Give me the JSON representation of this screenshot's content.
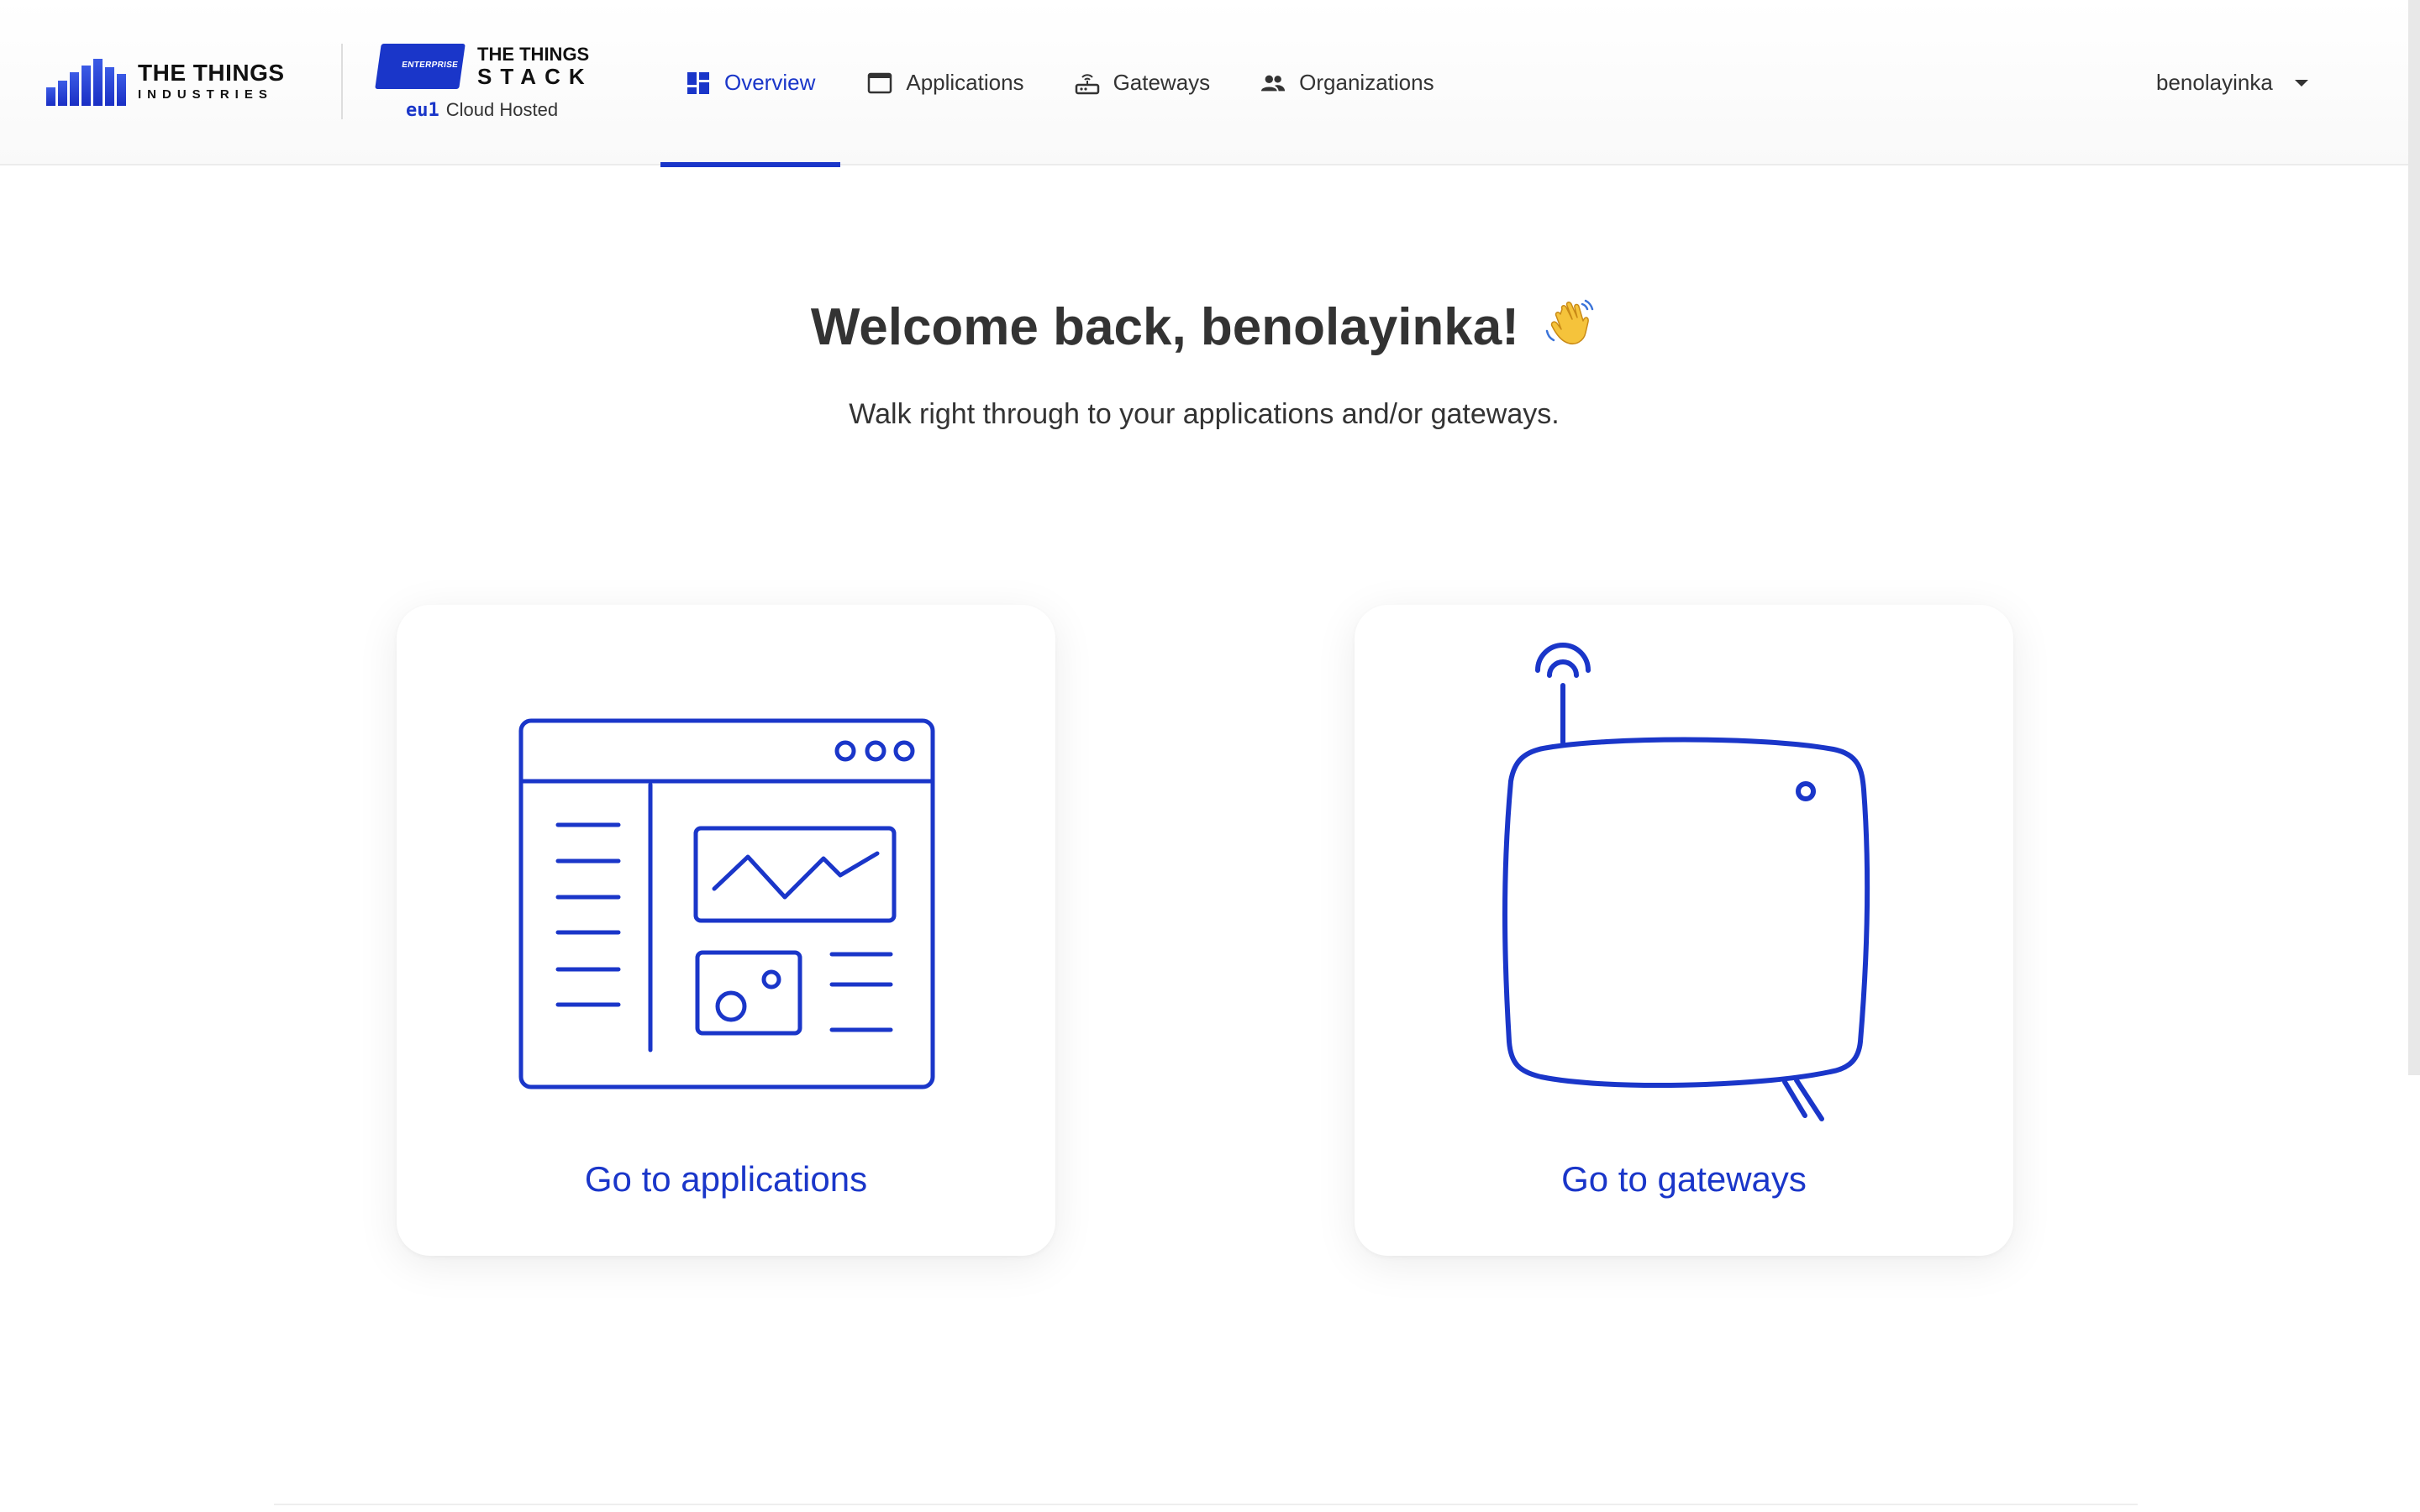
{
  "header": {
    "brand_line1": "THE THINGS",
    "brand_line2": "INDUSTRIES",
    "product_badge": "ENTERPRISE",
    "product_line1": "THE THINGS",
    "product_line2": "STACK",
    "cluster": "eu1",
    "hosting": "Cloud Hosted",
    "nav": [
      {
        "label": "Overview",
        "icon": "overview-icon",
        "active": true
      },
      {
        "label": "Applications",
        "icon": "applications-icon",
        "active": false
      },
      {
        "label": "Gateways",
        "icon": "gateway-icon",
        "active": false
      },
      {
        "label": "Organizations",
        "icon": "organizations-icon",
        "active": false
      }
    ],
    "user": "benolayinka"
  },
  "main": {
    "welcome": "Welcome back, benolayinka!",
    "emoji": "waving-hand-icon",
    "subtitle": "Walk right through to your applications and/or gateways.",
    "cards": [
      {
        "label": "Go to applications",
        "illustration": "application-window-icon"
      },
      {
        "label": "Go to gateways",
        "illustration": "gateway-device-icon"
      }
    ]
  },
  "colors": {
    "accent": "#1a36c9",
    "text": "#333333"
  }
}
